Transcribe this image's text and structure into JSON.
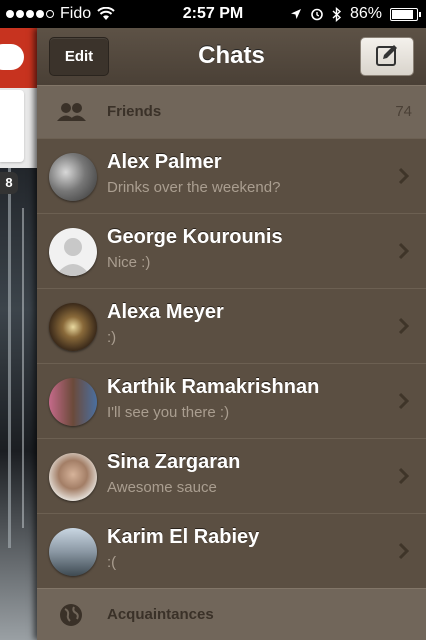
{
  "status_bar": {
    "carrier": "Fido",
    "time": "2:57 PM",
    "battery": "86%",
    "battery_level": 0.86
  },
  "nav": {
    "title": "Chats",
    "edit_label": "Edit",
    "compose_icon": "compose-icon"
  },
  "peek": {
    "badge": "8"
  },
  "sections": {
    "friends": {
      "label": "Friends",
      "count": "74",
      "icon": "people-icon"
    },
    "acquaintances": {
      "label": "Acquaintances",
      "icon": "globe-icon"
    }
  },
  "chats": [
    {
      "name": "Alex Palmer",
      "message": "Drinks over the weekend?"
    },
    {
      "name": "George Kourounis",
      "message": "Nice :)"
    },
    {
      "name": "Alexa Meyer",
      "message": ":)"
    },
    {
      "name": "Karthik Ramakrishnan",
      "message": "I'll see you there :)"
    },
    {
      "name": "Sina Zargaran",
      "message": "Awesome sauce"
    },
    {
      "name": "Karim El Rabiey",
      "message": ":("
    }
  ],
  "colors": {
    "panel_bg": "#5b4f42",
    "section_bg": "#71665a",
    "accent_red": "#c7331f"
  }
}
